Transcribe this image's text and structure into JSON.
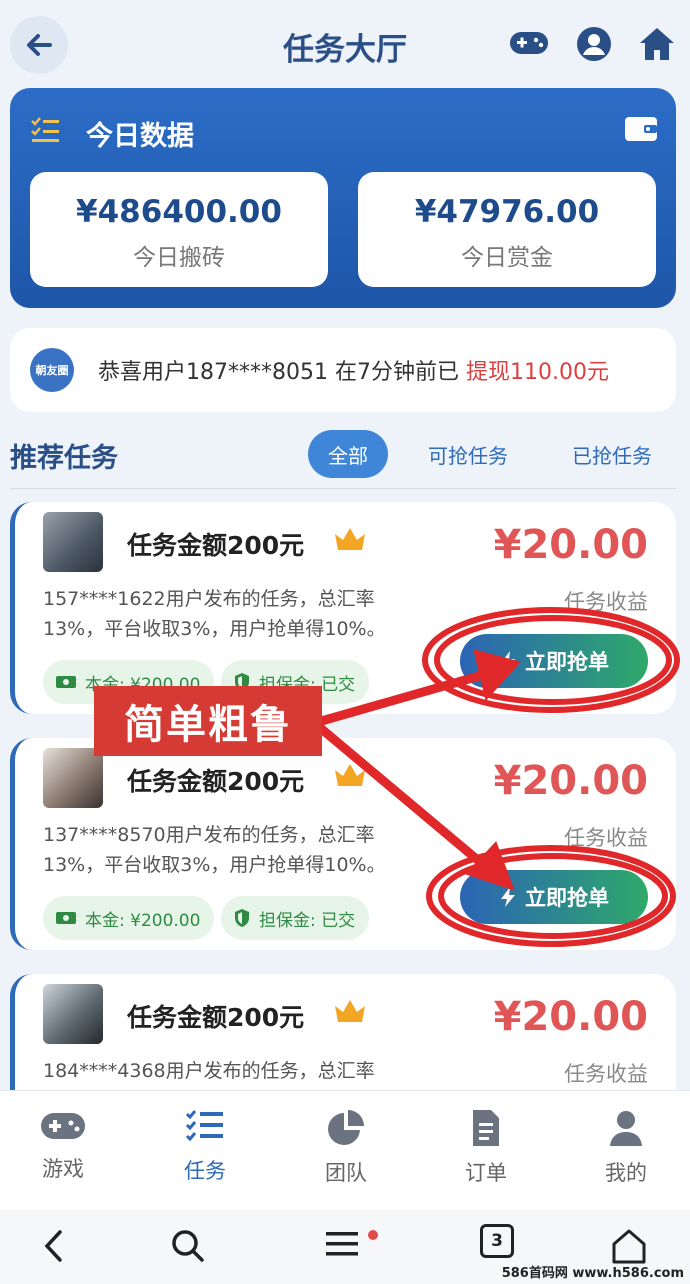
{
  "header": {
    "title": "任务大厅"
  },
  "stats": {
    "title": "今日数据",
    "items": [
      {
        "value": "¥486400.00",
        "label": "今日搬砖"
      },
      {
        "value": "¥47976.00",
        "label": "今日赏金"
      }
    ]
  },
  "notice": {
    "icon_text": "朝友圈",
    "text": "恭喜用户187****8051 在7分钟前已 ",
    "amount": "提现110.00元"
  },
  "section": {
    "title": "推荐任务",
    "filters": [
      "全部",
      "可抢任务",
      "已抢任务"
    ]
  },
  "tasks": [
    {
      "title": "任务金额200元",
      "price": "¥20.00",
      "income_label": "任务收益",
      "desc": "157****1622用户发布的任务，总汇率13%，平台收取3%，用户抢单得10%。",
      "principal": "本金: ¥200.00",
      "deposit": "担保金: 已交",
      "button": "立即抢单"
    },
    {
      "title": "任务金额200元",
      "price": "¥20.00",
      "income_label": "任务收益",
      "desc": "137****8570用户发布的任务，总汇率13%，平台收取3%，用户抢单得10%。",
      "principal": "本金: ¥200.00",
      "deposit": "担保金: 已交",
      "button": "立即抢单"
    },
    {
      "title": "任务金额200元",
      "price": "¥20.00",
      "income_label": "任务收益",
      "desc": "184****4368用户发布的任务，总汇率"
    }
  ],
  "annotation": {
    "label": "简单粗鲁",
    "color": "#d63a34"
  },
  "tabbar": {
    "items": [
      {
        "label": "游戏",
        "icon": "gamepad-icon"
      },
      {
        "label": "任务",
        "icon": "tasks-icon",
        "active": true
      },
      {
        "label": "团队",
        "icon": "pie-chart-icon"
      },
      {
        "label": "订单",
        "icon": "document-icon"
      },
      {
        "label": "我的",
        "icon": "user-icon"
      }
    ]
  },
  "system_nav": {
    "tabs_count": "3"
  },
  "watermark": "586首码网 www.h586.com",
  "colors": {
    "primary": "#2d6ab8",
    "price": "#e05555",
    "tag_green": "#2f8a43",
    "notice_amount": "#d94141"
  }
}
